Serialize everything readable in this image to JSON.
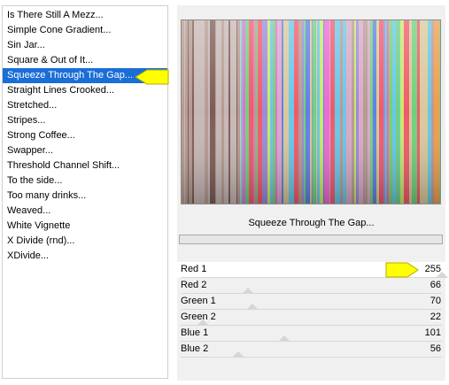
{
  "filters": [
    "Is There Still A Mezz...",
    "Simple Cone Gradient...",
    "Sin Jar...",
    "Square & Out of It...",
    "Squeeze Through The Gap...",
    "Straight Lines Crooked...",
    "Stretched...",
    "Stripes...",
    "Strong Coffee...",
    "Swapper...",
    "Threshold Channel Shift...",
    "To the side...",
    "Too many drinks...",
    "Weaved...",
    "White Vignette",
    "X Divide (rnd)...",
    "XDivide..."
  ],
  "selected_index": 4,
  "filter_title": "Squeeze Through The Gap...",
  "progress": 0,
  "params": [
    {
      "label": "Red 1",
      "value": "255",
      "level": 1.0
    },
    {
      "label": "Red 2",
      "value": "66",
      "level": 0.259
    },
    {
      "label": "Green 1",
      "value": "70",
      "level": 0.275
    },
    {
      "label": "Green 2",
      "value": "22",
      "level": 0.086
    },
    {
      "label": "Blue 1",
      "value": "101",
      "level": 0.396
    },
    {
      "label": "Blue 2",
      "value": "56",
      "level": 0.22
    }
  ],
  "colors": {
    "selection": "#1a6ed6",
    "pointer_arrow": "#ffff00",
    "preview_palette": [
      "#c7b8b6",
      "#b79a92",
      "#d8a9c7",
      "#e96ad4",
      "#9b8ad9",
      "#6fd17a",
      "#c9e86a",
      "#f29b4b",
      "#ef5a6a",
      "#5f7fe6",
      "#6ac6e8",
      "#d9c89a",
      "#7d5c55"
    ]
  },
  "icons": [
    "yellow-pointer-arrow-icon"
  ]
}
